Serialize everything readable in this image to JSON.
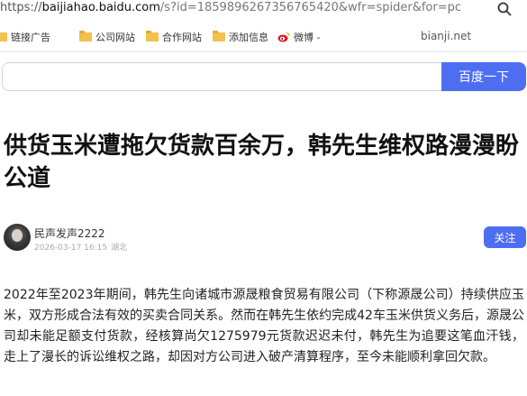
{
  "address_bar": {
    "url_prefix": "https://",
    "url_host": "baijiahao.baidu.com",
    "url_path": "/s?id=1859896267356765420&wfr=spider&for=pc"
  },
  "bookmarks": {
    "items": [
      {
        "label": "链接广告",
        "icon": "folder-icon"
      },
      {
        "label": "公司网站",
        "icon": "folder-icon"
      },
      {
        "label": "合作网站",
        "icon": "folder-icon"
      },
      {
        "label": "添加信息",
        "icon": "folder-icon"
      },
      {
        "label": "微博 -",
        "icon": "weibo-icon"
      }
    ],
    "site_label": "bianji.net"
  },
  "search": {
    "value": "",
    "button_label": "百度一下"
  },
  "article": {
    "title": "供货玉米遭拖欠货款百余万，韩先生维权路漫漫盼公道",
    "author_name": "民声发声2222",
    "datetime": "2026-03-17 16:15",
    "location": "湖北",
    "follow_label": "关注",
    "paragraph": "2022年至2023年期间，韩先生向诸城市源晟粮食贸易有限公司（下称源晟公司）持续供应玉米，双方形成合法有效的买卖合同关系。然而在韩先生依约完成42车玉米供货义务后，源晟公司却未能足额支付货款，经核算尚欠1275979元货款迟迟未付，韩先生为追要这笔血汗钱，走上了漫长的诉讼维权之路，却因对方公司进入破产清算程序，至今未能顺利拿回欠款。"
  },
  "colors": {
    "accent": "#4e6ef2",
    "folder": "#f2c14e"
  }
}
